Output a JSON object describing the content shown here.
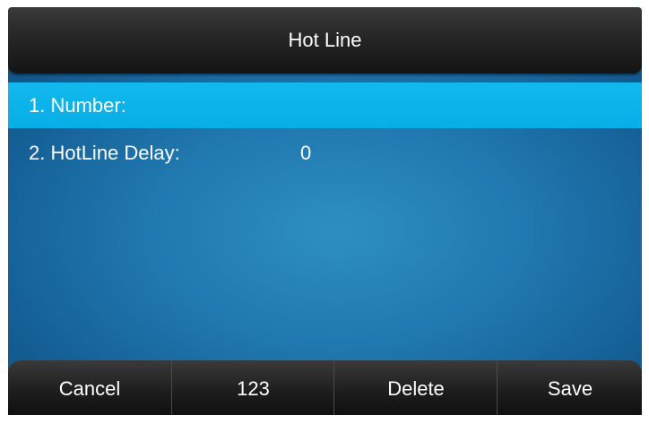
{
  "header": {
    "title": "Hot Line"
  },
  "menu": {
    "items": [
      {
        "label": "1. Number:",
        "value": ""
      },
      {
        "label": "2. HotLine Delay:",
        "value": "0"
      }
    ]
  },
  "softkeys": [
    {
      "label": "Cancel"
    },
    {
      "label": "123"
    },
    {
      "label": "Delete"
    },
    {
      "label": "Save"
    }
  ],
  "colors": {
    "title_bar": "#1e1e1e",
    "selected_row": "#0bb4ea",
    "background": "#1f77ae",
    "text": "#ffffff"
  }
}
